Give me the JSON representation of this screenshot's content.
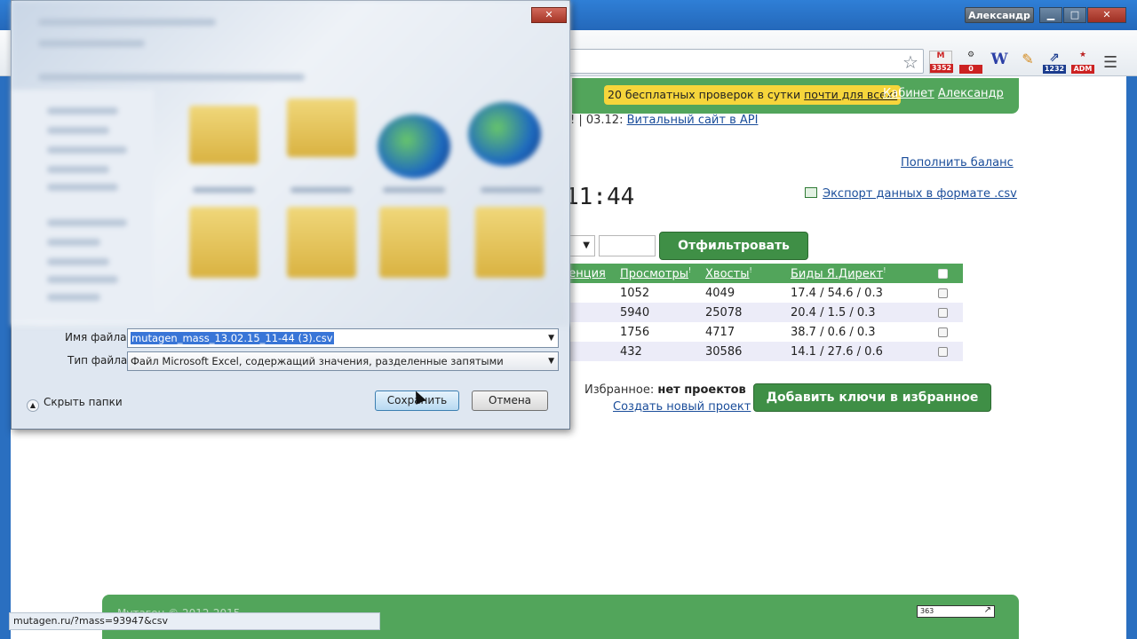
{
  "window": {
    "user": "Александр",
    "minimize": "▁",
    "maximize": "□",
    "close": "✕"
  },
  "extensions": [
    {
      "name": "gmail",
      "badge": "3352"
    },
    {
      "name": "tool",
      "badge": "0"
    },
    {
      "name": "w",
      "label": "W"
    },
    {
      "name": "pencil",
      "badge": ""
    },
    {
      "name": "link",
      "badge": "1232"
    },
    {
      "name": "adm",
      "badge": "ADM"
    }
  ],
  "header": {
    "promo_text": "20 бесплатных проверок в сутки ",
    "promo_link": "почти для всех!",
    "cabinet": "Кабинет",
    "user_link": "Александр"
  },
  "news": {
    "prefix": "! | 03.12: ",
    "link": "Витальный сайт в API"
  },
  "topup": "Пополнить баланс",
  "time": "11:44",
  "export": "Экспорт данных в формате .csv",
  "filter_button": "Отфильтровать",
  "table": {
    "headers": [
      "ренция",
      "Просмотры",
      "Хвосты",
      "Биды Я.Директ"
    ],
    "rows": [
      {
        "views": "1052",
        "tails": "4049",
        "bids": "17.4 / 54.6 / 0.3"
      },
      {
        "views": "5940",
        "tails": "25078",
        "bids": "20.4 / 1.5 / 0.3"
      },
      {
        "views": "1756",
        "tails": "4717",
        "bids": "38.7 / 0.6 / 0.3"
      },
      {
        "views": "432",
        "tails": "30586",
        "bids": "14.1 / 27.6 / 0.6"
      }
    ]
  },
  "favorites": {
    "label": "Избранное: ",
    "value": "нет проектов",
    "new_project": "Создать новый проект",
    "add_button": "Добавить ключи в избранное"
  },
  "footer": {
    "text": "Мутаген © 2012-2015",
    "counter": "363"
  },
  "statusbar": "mutagen.ru/?mass=93947&csv",
  "dialog": {
    "filename_label": "Имя файла:",
    "filename_value": "mutagen_mass_13.02.15_11-44 (3).csv",
    "filetype_label": "Тип файла:",
    "filetype_value": "Файл Microsoft Excel, содержащий значения, разделенные запятыми",
    "hide_folders": "Скрыть папки",
    "save": "Сохранить",
    "cancel": "Отмена"
  }
}
